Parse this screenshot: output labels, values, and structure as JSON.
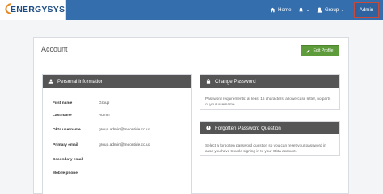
{
  "brand": {
    "logo_text": "ENERGYSYS",
    "colors": {
      "nav": "#346eac",
      "accent_green": "#5d9b3b",
      "panel_header": "#555555",
      "admin_outline": "#c94a3b"
    }
  },
  "nav": {
    "home": {
      "label": "Home",
      "icon": "home-icon"
    },
    "notifications": {
      "icon": "bell-icon"
    },
    "group": {
      "label": "Group",
      "icon": "user-icon"
    },
    "admin": {
      "label": "Admin"
    }
  },
  "page": {
    "title": "Account",
    "edit_button": "Edit Profile"
  },
  "personal": {
    "heading": "Personal Information",
    "rows": [
      {
        "label": "First name",
        "value": "Group"
      },
      {
        "label": "Last name",
        "value": "Admin"
      },
      {
        "label": "Okta username",
        "value": "group.admin@moontide.co.uk"
      },
      {
        "label": "Primary email",
        "value": "group.admin@moontide.co.uk"
      },
      {
        "label": "Secondary email",
        "value": ""
      },
      {
        "label": "Mobile phone",
        "value": ""
      }
    ]
  },
  "change_password": {
    "heading": "Change Password",
    "text": "Password requirements: at least 16 characters, a lowercase letter, no parts of your username."
  },
  "forgotten_question": {
    "heading": "Forgotten Password Question",
    "text": "Select a forgotten password question so you can reset your password in case you have trouble signing in to your Okta account."
  }
}
